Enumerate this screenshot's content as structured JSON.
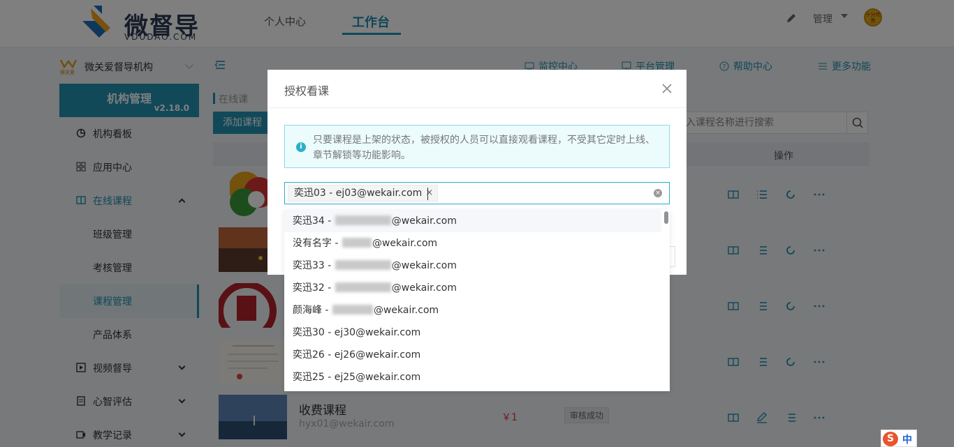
{
  "brand": {
    "name": "微督导",
    "domain": "VDUDAO.COM"
  },
  "topnav": {
    "items": [
      "个人中心",
      "工作台"
    ],
    "active": "工作台"
  },
  "user": {
    "admin_label": "管理",
    "avatar_text": "十分优秀"
  },
  "sidebar": {
    "org_name": "微关爱督导机构",
    "org_logo_text": "微关爱",
    "mgmt_title": "机构管理",
    "version": "v2.18.0",
    "items": [
      {
        "label": "机构看板"
      },
      {
        "label": "应用中心"
      },
      {
        "label": "在线课程"
      },
      {
        "label": "班级管理"
      },
      {
        "label": "考核管理"
      },
      {
        "label": "课程管理"
      },
      {
        "label": "产品体系"
      },
      {
        "label": "视频督导"
      },
      {
        "label": "心智评估"
      },
      {
        "label": "教学记录"
      }
    ]
  },
  "main": {
    "functions": [
      "监控中心",
      "平台管理",
      "帮助中心",
      "更多功能"
    ],
    "breadcrumb": "在线课",
    "add_button": "添加课程",
    "search_placeholder": "入课程名称进行搜索",
    "table_head_op": "操作",
    "last_row": {
      "name": "收费课程",
      "email": "hyx01@wekair.com",
      "price": "￥1",
      "status": "审核成功"
    }
  },
  "modal": {
    "title": "授权看课",
    "notice": "只要课程是上架的状态，被授权的人员可以直接观看课程，不受其它定时上线、章节解锁等功能影响。",
    "selected_tag": "奕迅03 - ej03@wekair.com"
  },
  "dropdown": {
    "items": [
      {
        "prefix": "奕迅34 - ",
        "suffix": "@wekair.com"
      },
      {
        "prefix": "没有名字 - ",
        "suffix": "@wekair.com"
      },
      {
        "prefix": "奕迅33 - ",
        "suffix": "@wekair.com"
      },
      {
        "prefix": "奕迅32 - ",
        "suffix": "@wekair.com"
      },
      {
        "prefix": "颜海峰 - ",
        "suffix": "@wekair.com"
      },
      {
        "prefix": "奕迅30 - ej30@wekair.com",
        "suffix": ""
      },
      {
        "prefix": "奕迅26 - ej26@wekair.com",
        "suffix": ""
      },
      {
        "prefix": "奕迅25 - ej25@wekair.com",
        "suffix": ""
      }
    ]
  },
  "ime": {
    "logo": "S",
    "mode": "中"
  },
  "colors": {
    "primary": "#2393b2",
    "accent": "#1f8fb3",
    "price": "#e4393c"
  }
}
